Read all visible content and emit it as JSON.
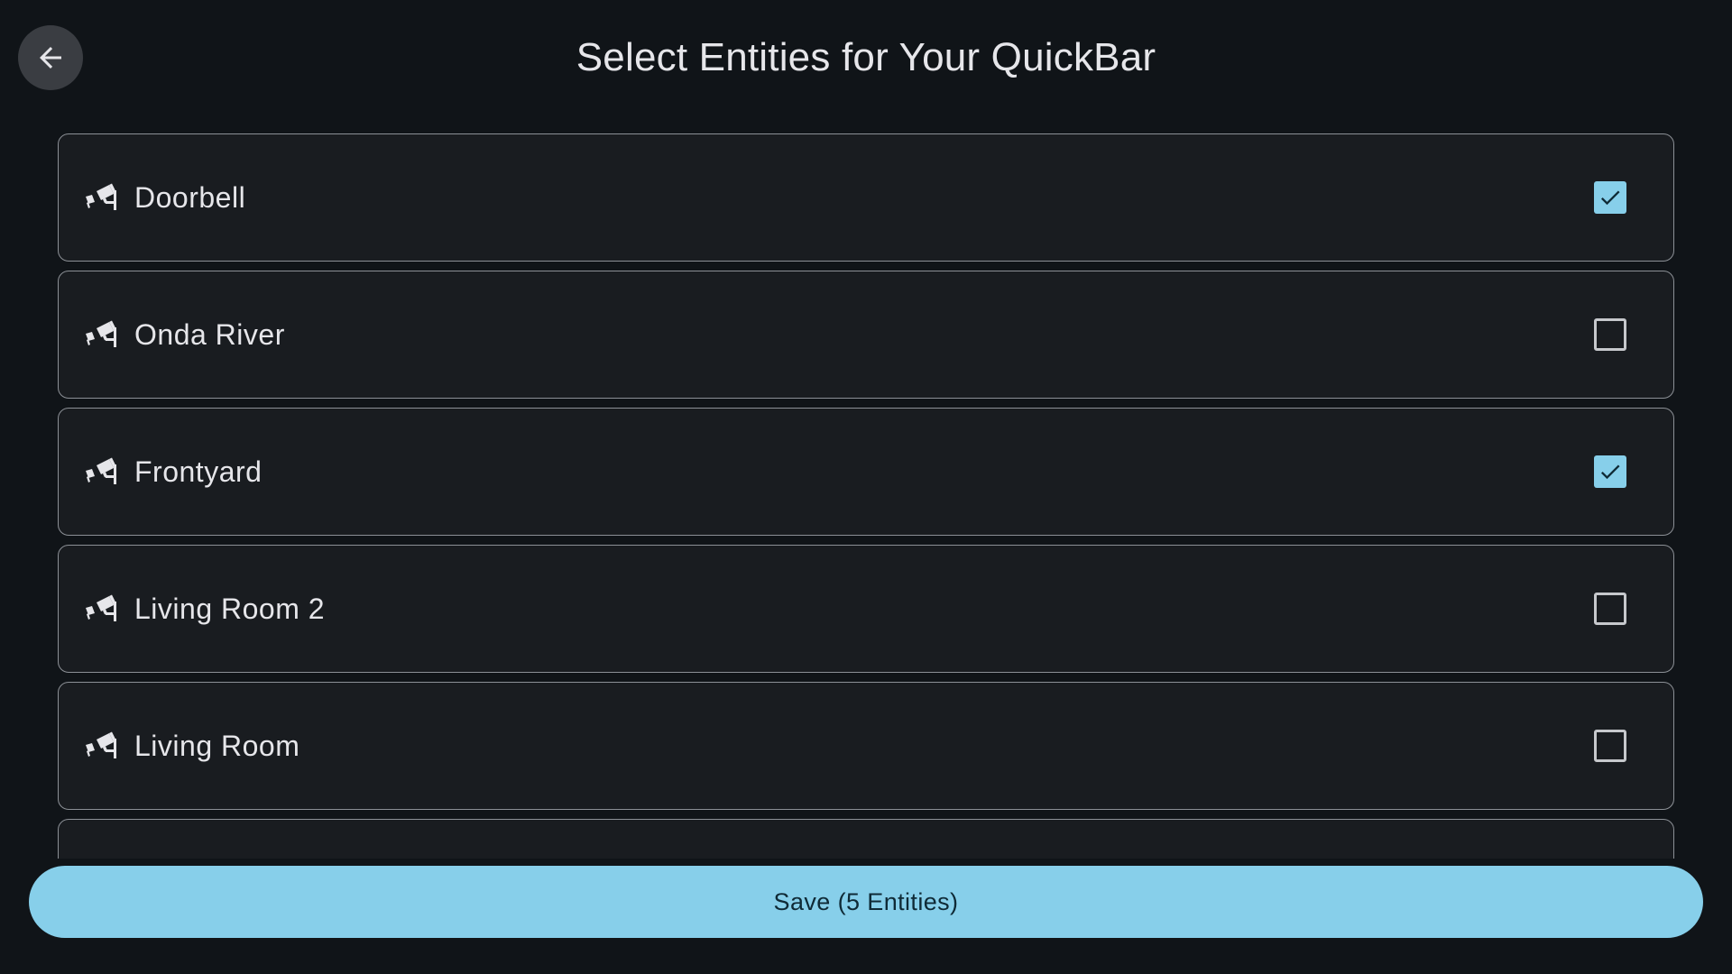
{
  "header": {
    "title": "Select Entities for Your QuickBar",
    "back_icon": "arrow-left-icon"
  },
  "entities": [
    {
      "label": "Doorbell",
      "icon": "cctv-camera-icon",
      "checked": true
    },
    {
      "label": "Onda River",
      "icon": "cctv-camera-icon",
      "checked": false
    },
    {
      "label": "Frontyard",
      "icon": "cctv-camera-icon",
      "checked": true
    },
    {
      "label": "Living Room 2",
      "icon": "cctv-camera-icon",
      "checked": false
    },
    {
      "label": "Living Room",
      "icon": "cctv-camera-icon",
      "checked": false
    },
    {
      "label": "",
      "icon": "",
      "checked": false
    }
  ],
  "footer": {
    "save_label": "Save (5 Entities)"
  },
  "colors": {
    "background": "#101418",
    "card": "#191c20",
    "accent": "#87cfea",
    "text": "#e6e6ea"
  }
}
